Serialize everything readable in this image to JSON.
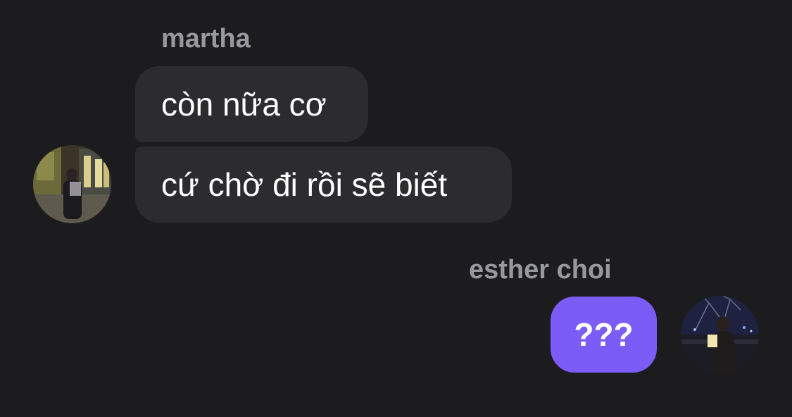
{
  "conversation": {
    "groups": [
      {
        "sender": "martha",
        "messages": [
          "còn nữa cơ",
          "cứ chờ đi rồi sẽ biết"
        ]
      },
      {
        "sender": "esther choi",
        "messages": [
          "???"
        ]
      }
    ]
  },
  "colors": {
    "background": "#1c1c1e",
    "incoming_bubble": "#2c2c2e",
    "outgoing_bubble": "#7b5cf6",
    "sender_name": "#98989f",
    "message_text": "#ffffff"
  }
}
